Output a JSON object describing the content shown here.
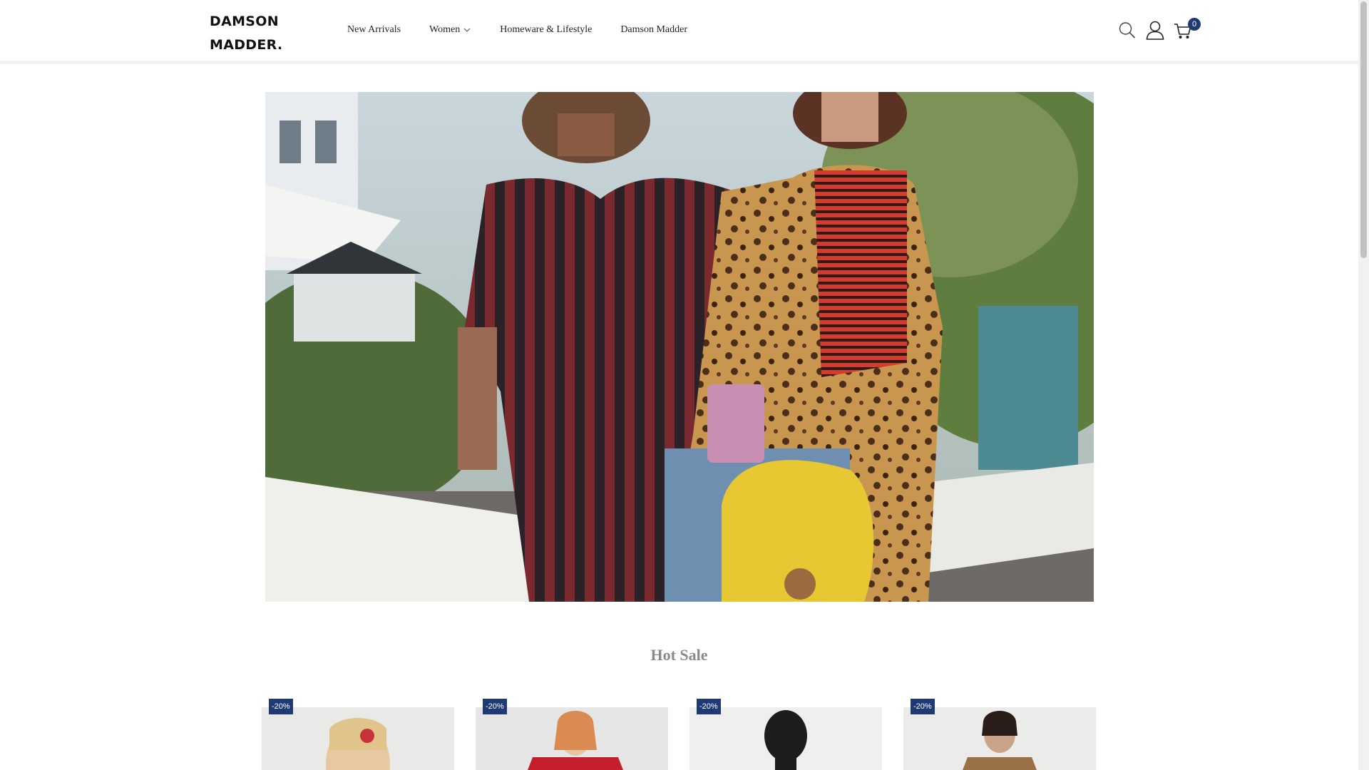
{
  "brand": {
    "logo_line1": "DAMSON",
    "logo_line2": "MADDER."
  },
  "nav": {
    "items": [
      {
        "label": "New Arrivals"
      },
      {
        "label": "Women"
      },
      {
        "label": "Homeware & Lifestyle"
      },
      {
        "label": "Damson Madder"
      }
    ]
  },
  "header": {
    "cart_count": "0"
  },
  "icons": {
    "search": "search-icon",
    "account": "user-icon",
    "cart": "cart-icon",
    "dropdown": "chevron-down-icon"
  },
  "colors": {
    "accent": "#1f3a73",
    "section_title": "#8a8a8a"
  },
  "section": {
    "title": "Hot Sale"
  },
  "products": [
    {
      "badge": "-20%"
    },
    {
      "badge": "-20%"
    },
    {
      "badge": "-20%"
    },
    {
      "badge": "-20%"
    }
  ]
}
